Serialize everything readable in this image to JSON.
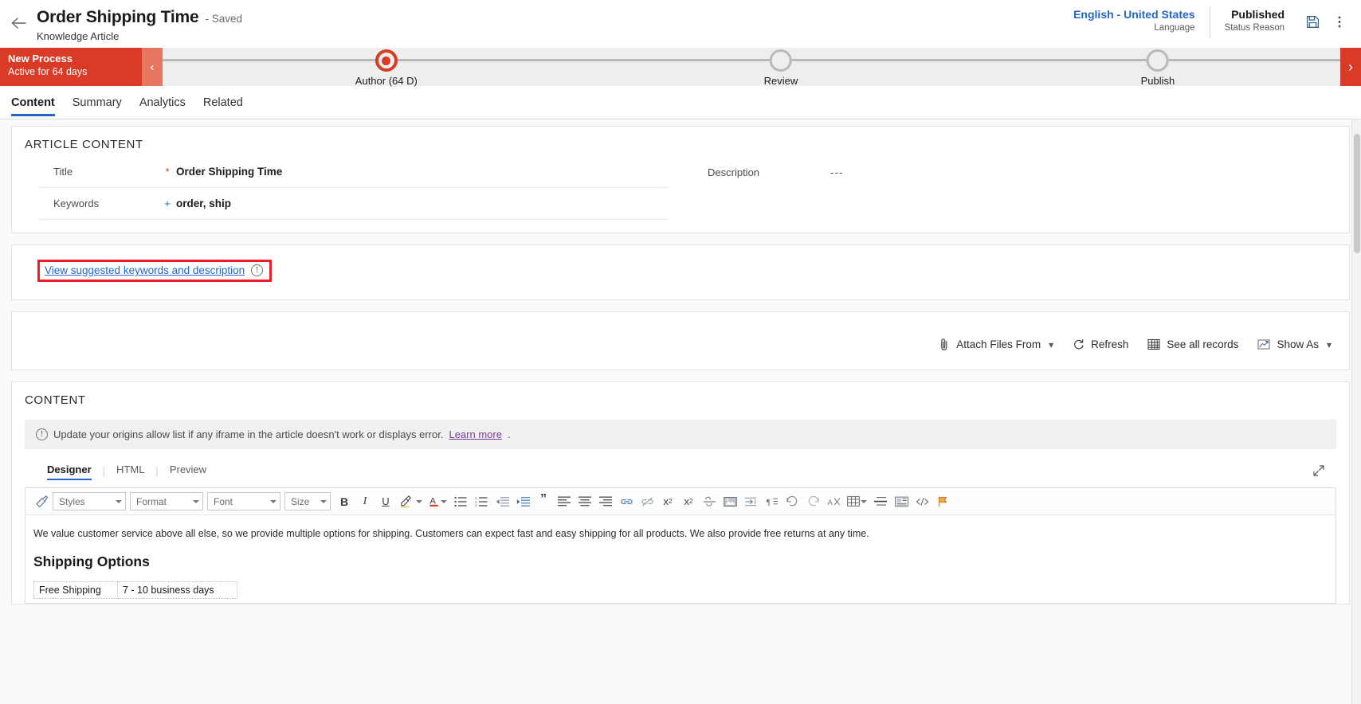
{
  "header": {
    "back_icon": "back-arrow-icon",
    "title": "Order Shipping Time",
    "saved_state": "- Saved",
    "subtitle": "Knowledge Article",
    "language_value": "English - United States",
    "language_label": "Language",
    "status_value": "Published",
    "status_label": "Status Reason",
    "save_icon": "save-disk-icon",
    "more_icon": "more-vertical-icon"
  },
  "process_flow": {
    "stage_title": "New Process",
    "stage_subtitle": "Active for 64 days",
    "collapse_icon": "chevron-left-icon",
    "next_icon": "chevron-right-icon",
    "stages": [
      {
        "label": "Author  (64 D)",
        "active": true
      },
      {
        "label": "Review",
        "active": false
      },
      {
        "label": "Publish",
        "active": false
      }
    ]
  },
  "tabs": [
    {
      "label": "Content",
      "active": true
    },
    {
      "label": "Summary",
      "active": false
    },
    {
      "label": "Analytics",
      "active": false
    },
    {
      "label": "Related",
      "active": false
    }
  ],
  "article_content": {
    "section_title": "ARTICLE CONTENT",
    "fields_left": [
      {
        "label": "Title",
        "marker": "*",
        "marker_type": "required",
        "value": "Order Shipping Time"
      },
      {
        "label": "Keywords",
        "marker": "+",
        "marker_type": "recommended",
        "value": "order, ship"
      }
    ],
    "fields_right": [
      {
        "label": "Description",
        "marker": "",
        "marker_type": "none",
        "value": "---"
      }
    ]
  },
  "suggestion": {
    "link_text": "View suggested keywords and description",
    "info_icon": "info-circle-icon",
    "info_glyph": "!",
    "highlight_color": "#ef1c25"
  },
  "attachments_toolbar": [
    {
      "label": "Attach Files From",
      "icon": "paperclip-icon",
      "has_caret": true
    },
    {
      "label": "Refresh",
      "icon": "refresh-icon",
      "has_caret": false
    },
    {
      "label": "See all records",
      "icon": "grid-table-icon",
      "has_caret": false
    },
    {
      "label": "Show As",
      "icon": "chart-image-icon",
      "has_caret": true
    }
  ],
  "content_section": {
    "section_title": "CONTENT",
    "notice_icon": "info-circle-icon",
    "notice_text": "Update your origins allow list if any iframe in the article doesn't work or displays error.",
    "notice_link": "Learn more",
    "notice_suffix": ".",
    "editor_tabs": [
      {
        "label": "Designer",
        "active": true
      },
      {
        "label": "HTML",
        "active": false
      },
      {
        "label": "Preview",
        "active": false
      }
    ],
    "expand_icon": "expand-diagonal-icon"
  },
  "rte_toolbar": {
    "format_painter_icon": "format-painter-icon",
    "combos": [
      {
        "name": "styles",
        "label": "Styles"
      },
      {
        "name": "format",
        "label": "Format"
      },
      {
        "name": "font",
        "label": "Font"
      },
      {
        "name": "size",
        "label": "Size"
      }
    ],
    "buttons": [
      {
        "name": "bold-button",
        "glyph": "B",
        "style": "bold"
      },
      {
        "name": "italic-button",
        "glyph": "I",
        "style": "italic"
      },
      {
        "name": "underline-button",
        "glyph": "U",
        "style": "underline"
      },
      {
        "name": "text-highlight-button",
        "glyph": "highlight-icon",
        "style": "icon"
      },
      {
        "name": "font-color-button",
        "glyph": "A",
        "style": "fontcolor"
      },
      {
        "name": "bulleted-list-button",
        "glyph": "bullet-list-icon",
        "style": "icon"
      },
      {
        "name": "numbered-list-button",
        "glyph": "numbered-list-icon",
        "style": "icon"
      },
      {
        "name": "decrease-indent-button",
        "glyph": "outdent-icon",
        "style": "icon"
      },
      {
        "name": "increase-indent-button",
        "glyph": "indent-icon",
        "style": "icon"
      },
      {
        "name": "blockquote-button",
        "glyph": "”",
        "style": "plain"
      },
      {
        "name": "align-left-button",
        "glyph": "align-left-icon",
        "style": "icon"
      },
      {
        "name": "align-center-button",
        "glyph": "align-center-icon",
        "style": "icon"
      },
      {
        "name": "align-right-button",
        "glyph": "align-right-icon",
        "style": "icon"
      },
      {
        "name": "insert-link-button",
        "glyph": "link-icon",
        "style": "icon"
      },
      {
        "name": "unlink-button",
        "glyph": "unlink-icon",
        "style": "icon"
      },
      {
        "name": "superscript-button",
        "glyph": "superscript-icon",
        "style": "icon"
      },
      {
        "name": "subscript-button",
        "glyph": "subscript-icon",
        "style": "icon"
      },
      {
        "name": "strikethrough-button",
        "glyph": "strikethrough-icon",
        "style": "icon"
      },
      {
        "name": "insert-image-button",
        "glyph": "image-icon",
        "style": "icon"
      },
      {
        "name": "insert-break-button",
        "glyph": "page-break-icon",
        "style": "icon"
      },
      {
        "name": "rtl-direction-button",
        "glyph": "rtl-icon",
        "style": "icon"
      },
      {
        "name": "undo-button",
        "glyph": "undo-icon",
        "style": "icon"
      },
      {
        "name": "redo-button",
        "glyph": "redo-icon",
        "style": "icon"
      },
      {
        "name": "remove-format-button",
        "glyph": "clear-format-icon",
        "style": "icon"
      },
      {
        "name": "insert-table-button",
        "glyph": "table-icon",
        "style": "icon"
      },
      {
        "name": "horizontal-rule-button",
        "glyph": "horizontal-rule-icon",
        "style": "icon"
      },
      {
        "name": "insert-template-button",
        "glyph": "template-icon",
        "style": "icon"
      },
      {
        "name": "source-code-button",
        "glyph": "code-icon",
        "style": "icon"
      },
      {
        "name": "flag-button",
        "glyph": "flag-icon",
        "style": "icon"
      }
    ]
  },
  "article_body": {
    "paragraph": "We value customer service above all else, so we provide multiple options for shipping. Customers can expect fast and easy shipping for all products. We also provide free returns at any time.",
    "heading": "Shipping Options",
    "table_rows": [
      {
        "option": "Free Shipping",
        "duration": "7 - 10 business days"
      }
    ]
  }
}
